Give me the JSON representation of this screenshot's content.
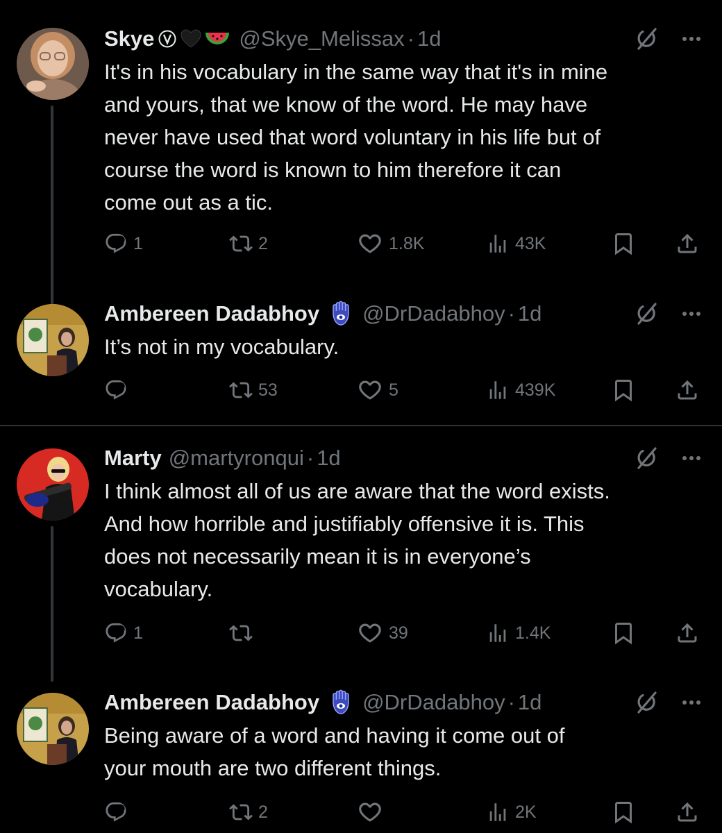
{
  "colors": {
    "background": "#000000",
    "text": "#e7e9ea",
    "muted": "#71767b",
    "divider": "#2f3336"
  },
  "posts": [
    {
      "name": "Skye",
      "badges": [
        "verified-v-icon",
        "black-heart-icon",
        "watermelon-icon"
      ],
      "handle": "@Skye_Melissax",
      "dot": "·",
      "time": "1d",
      "text": "It's in his vocabulary in the same way that it's in mine\nand yours, that we know of the word. He may have\nnever have used that word voluntary in his life but of\ncourse the word is known to him therefore it can\ncome out as a tic.",
      "replies": "1",
      "reposts": "2",
      "likes": "1.8K",
      "views": "43K"
    },
    {
      "name": "Ambereen Dadabhoy",
      "badges": [
        "hamsa-icon"
      ],
      "handle": "@DrDadabhoy",
      "dot": "·",
      "time": "1d",
      "text": "It’s not in my vocabulary.",
      "replies": "",
      "reposts": "53",
      "likes": "5",
      "views": "439K"
    },
    {
      "name": "Marty",
      "badges": [],
      "handle": "@martyronqui",
      "dot": "·",
      "time": "1d",
      "text": "I think almost all of us are aware that the word exists.\nAnd how horrible and justifiably offensive it is. This\ndoes not necessarily mean it is in everyone’s\nvocabulary.",
      "replies": "1",
      "reposts": "",
      "likes": "39",
      "views": "1.4K"
    },
    {
      "name": "Ambereen Dadabhoy",
      "badges": [
        "hamsa-icon"
      ],
      "handle": "@DrDadabhoy",
      "dot": "·",
      "time": "1d",
      "text": "Being aware of a word and having it come out of\nyour mouth are two different things.",
      "replies": "",
      "reposts": "2",
      "likes": "",
      "views": "2K"
    }
  ]
}
